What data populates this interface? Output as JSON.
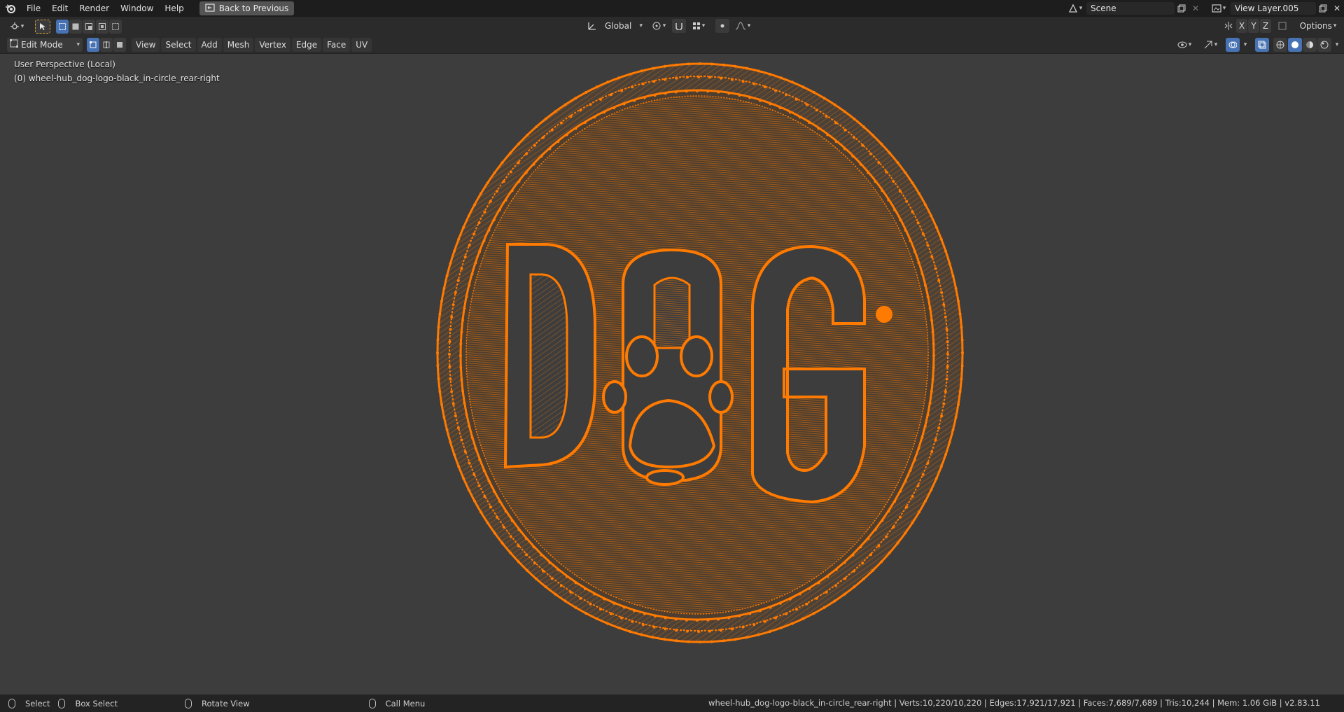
{
  "app": {
    "menus": [
      "File",
      "Edit",
      "Render",
      "Window",
      "Help"
    ],
    "back_button": "Back to Previous",
    "scene_name": "Scene",
    "view_layer": "View Layer.005"
  },
  "header": {
    "transform_orientation": "Global",
    "axes": [
      "X",
      "Y",
      "Z"
    ],
    "options_label": "Options",
    "mode": "Edit Mode",
    "menus": [
      "View",
      "Select",
      "Add",
      "Mesh",
      "Vertex",
      "Edge",
      "Face",
      "UV"
    ]
  },
  "viewport": {
    "perspective_label": "User Perspective (Local)",
    "object_label": "(0) wheel-hub_dog-logo-black_in-circle_rear-right",
    "mesh_letters": [
      "D",
      "G"
    ],
    "wire_color": "#ff7a00"
  },
  "statusbar": {
    "select": "Select",
    "box_select": "Box Select",
    "rotate_view": "Rotate View",
    "call_menu": "Call Menu",
    "stats": "wheel-hub_dog-logo-black_in-circle_rear-right | Verts:10,220/10,220 | Edges:17,921/17,921 | Faces:7,689/7,689 | Tris:10,244 | Mem: 1.06 GiB | v2.83.11"
  }
}
